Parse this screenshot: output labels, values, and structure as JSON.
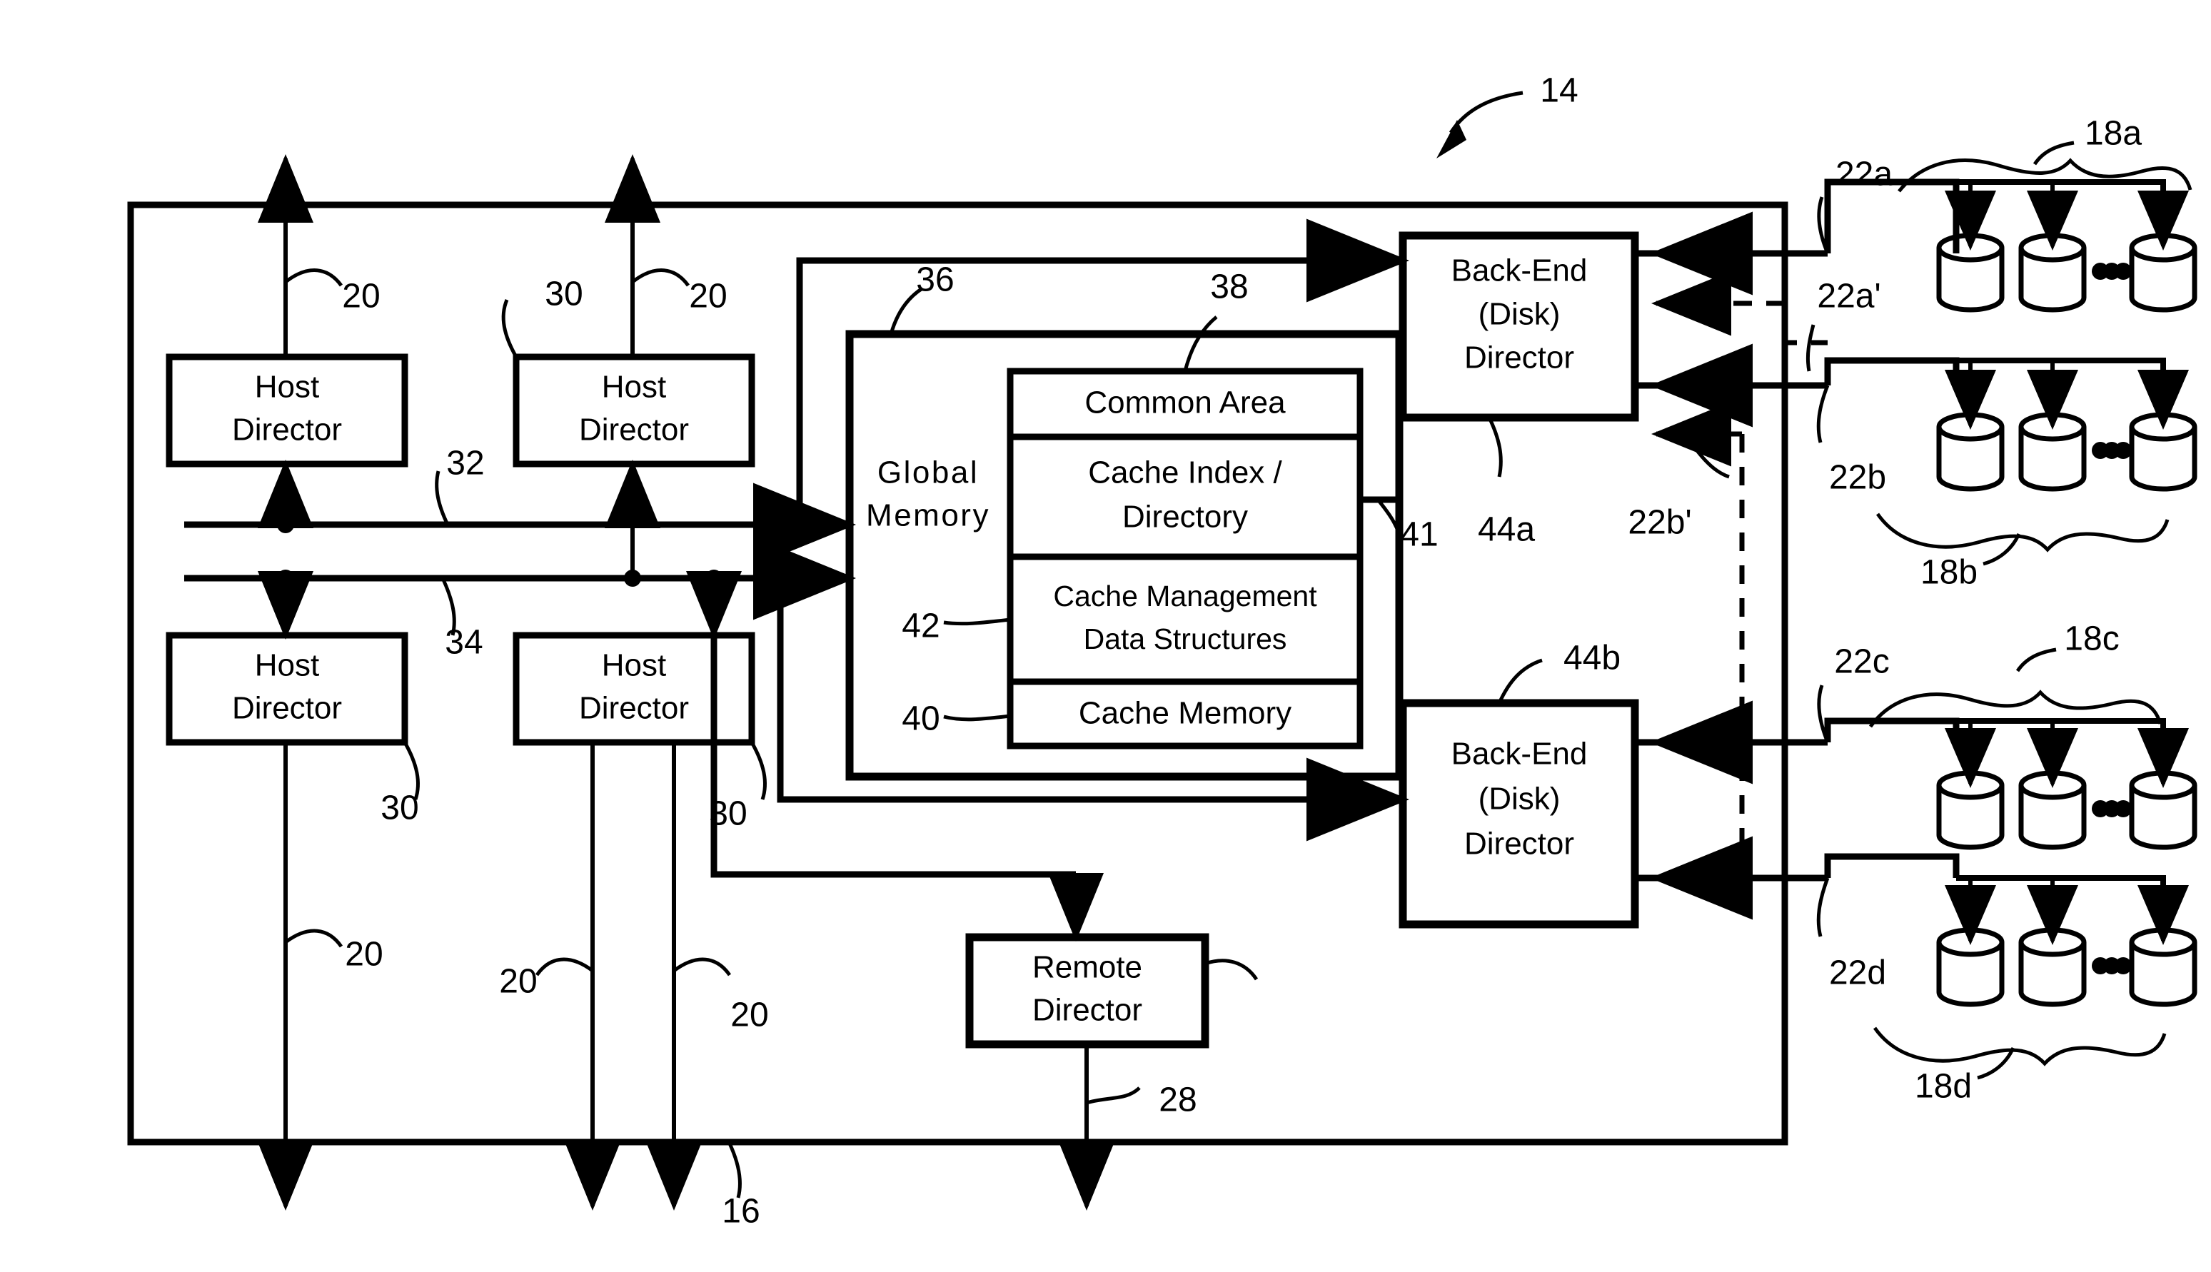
{
  "figure": {
    "title_ref": "14",
    "system_bus_ref": "16"
  },
  "boxes": {
    "host_director_1": {
      "line1": "Host",
      "line2": "Director"
    },
    "host_director_2": {
      "line1": "Host",
      "line2": "Director"
    },
    "host_director_3": {
      "line1": "Host",
      "line2": "Director"
    },
    "host_director_4": {
      "line1": "Host",
      "line2": "Director"
    },
    "global_memory": {
      "line1": "Global",
      "line2": "Memory"
    },
    "common_area": {
      "label": "Common Area"
    },
    "cache_index": {
      "line1": "Cache Index /",
      "line2": "Directory"
    },
    "cache_mgmt": {
      "line1": "Cache Management",
      "line2": "Data Structures"
    },
    "cache_memory": {
      "label": "Cache Memory"
    },
    "backend_director_a": {
      "line1": "Back-End",
      "line2": "(Disk)",
      "line3": "Director"
    },
    "backend_director_b": {
      "line1": "Back-End",
      "line2": "(Disk)",
      "line3": "Director"
    },
    "remote_director": {
      "line1": "Remote",
      "line2": "Director"
    }
  },
  "refs": {
    "r14": "14",
    "r16": "16",
    "r20_top_a": "20",
    "r20_top_b": "20",
    "r20_bot_a": "20",
    "r20_bot_b": "20",
    "r20_bot_c": "20",
    "r28": "28",
    "r30_top_b": "30",
    "r30_bot_a": "30",
    "r30_bot_b": "30",
    "r32": "32",
    "r34": "34",
    "r36": "36",
    "r38": "38",
    "r40": "40",
    "r41": "41",
    "r42": "42",
    "r44a": "44a",
    "r44b": "44b",
    "r18a": "18a",
    "r18b": "18b",
    "r18c": "18c",
    "r18d": "18d",
    "r22a": "22a",
    "r22a_prime": "22a'",
    "r22b": "22b",
    "r22b_prime": "22b'",
    "r22c": "22c",
    "r22d": "22d"
  },
  "disk_arrays": [
    {
      "id": "18a",
      "bus": "22a",
      "disk_count_shown": 3,
      "ellipsis": true
    },
    {
      "id": "18b",
      "bus": "22b",
      "disk_count_shown": 3,
      "ellipsis": true
    },
    {
      "id": "18c",
      "bus": "22c",
      "disk_count_shown": 3,
      "ellipsis": true
    },
    {
      "id": "18d",
      "bus": "22d",
      "disk_count_shown": 3,
      "ellipsis": true
    }
  ],
  "colors": {
    "ink": "#000000",
    "paper": "#ffffff"
  }
}
